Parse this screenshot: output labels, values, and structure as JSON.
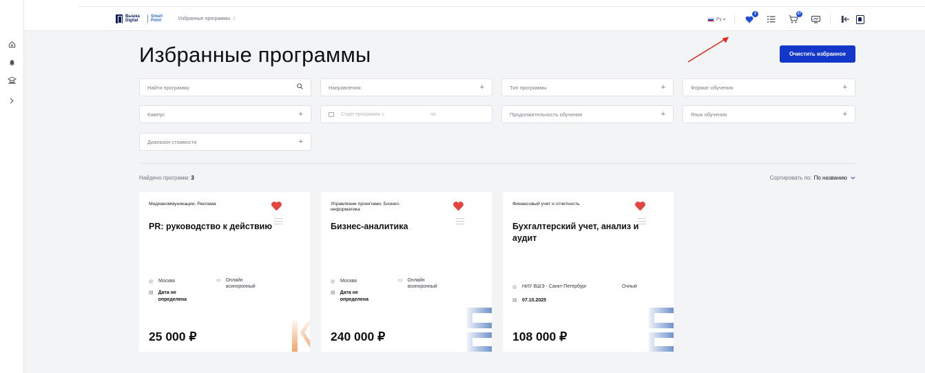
{
  "header": {
    "logo_text": "Вышка Digital",
    "logo_sub": "Smart Point",
    "breadcrumb": "Избранные программы",
    "breadcrumb_sep": "/",
    "lang": "Ру",
    "favorites_count": "3",
    "cart_count": "27",
    "icons": [
      "globe-flag-icon",
      "heart-icon",
      "list-icon",
      "cart-icon",
      "monitor-icon",
      "logout-icon",
      "avatar-icon"
    ]
  },
  "sidebar": {
    "icons": [
      "home-icon",
      "bell-icon",
      "education-icon",
      "chevron-right-icon"
    ]
  },
  "page": {
    "title": "Избранные программы",
    "clear_button": "Очистить избранное"
  },
  "filters": {
    "search_placeholder": "Найти программу",
    "directions": "Направления",
    "program_type": "Тип программы",
    "format": "Формат обучения",
    "campus": "Кампус",
    "start_from": "Старт программы с",
    "start_to": "по",
    "duration": "Продолжительность обучения",
    "language": "Язык обучения",
    "price_range": "Диапазон стоимости"
  },
  "results": {
    "found_label": "Найдено программ:",
    "found_count": "3",
    "sort_label": "Сортировать по:",
    "sort_value": "По названию"
  },
  "cards": [
    {
      "category": "Медиакоммуникации, Реклама",
      "title": "PR: руководство к действию",
      "location": "Москва",
      "format": "Онлайн асинхронный",
      "date": "Дата не определена",
      "price": "25 000 ₽",
      "accent": "#f0a56a"
    },
    {
      "category": "Управление проектами, Бизнес-информатика",
      "title": "Бизнес-аналитика",
      "location": "Москва",
      "format": "Онлайн асинхронный",
      "date": "Дата не определена",
      "price": "240 000 ₽",
      "accent": "#6f93cc"
    },
    {
      "category": "Финансовый учет и отчетность",
      "title": "Бухгалтерский учет, анализ и аудит",
      "location": "НИУ ВШЭ - Санкт-Петербург",
      "format": "Очный",
      "date": "07.10.2025",
      "price": "108 000 ₽",
      "accent": "#6f93cc"
    }
  ],
  "colors": {
    "primary": "#1337c9",
    "favorite": "#e5453f",
    "annotation_arrow": "#e02b22"
  }
}
